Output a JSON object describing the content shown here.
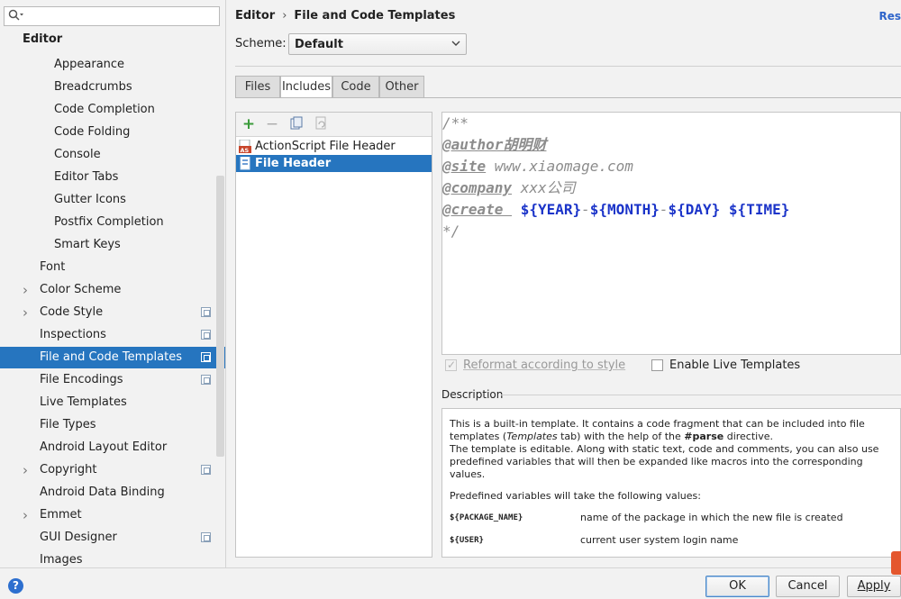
{
  "sidebar": {
    "search_placeholder": "",
    "search_icon": "magnifier-dropdown-icon",
    "root": "Editor",
    "items": [
      {
        "label": "Appearance",
        "indent": 2
      },
      {
        "label": "Breadcrumbs",
        "indent": 2
      },
      {
        "label": "Code Completion",
        "indent": 2
      },
      {
        "label": "Code Folding",
        "indent": 2
      },
      {
        "label": "Console",
        "indent": 2
      },
      {
        "label": "Editor Tabs",
        "indent": 2
      },
      {
        "label": "Gutter Icons",
        "indent": 2
      },
      {
        "label": "Postfix Completion",
        "indent": 2
      },
      {
        "label": "Smart Keys",
        "indent": 2
      },
      {
        "label": "Font",
        "indent": 1
      },
      {
        "label": "Color Scheme",
        "indent": 1,
        "expandable": true
      },
      {
        "label": "Code Style",
        "indent": 1,
        "expandable": true,
        "project": true
      },
      {
        "label": "Inspections",
        "indent": 1,
        "project": true
      },
      {
        "label": "File and Code Templates",
        "indent": 1,
        "project": true,
        "selected": true
      },
      {
        "label": "File Encodings",
        "indent": 1,
        "project": true
      },
      {
        "label": "Live Templates",
        "indent": 1
      },
      {
        "label": "File Types",
        "indent": 1
      },
      {
        "label": "Android Layout Editor",
        "indent": 1
      },
      {
        "label": "Copyright",
        "indent": 1,
        "expandable": true,
        "project": true
      },
      {
        "label": "Android Data Binding",
        "indent": 1
      },
      {
        "label": "Emmet",
        "indent": 1,
        "expandable": true
      },
      {
        "label": "GUI Designer",
        "indent": 1,
        "project": true
      },
      {
        "label": "Images",
        "indent": 1
      }
    ]
  },
  "header": {
    "crumb_parent": "Editor",
    "crumb_sep": "›",
    "crumb_current": "File and Code Templates",
    "reset_label": "Res"
  },
  "scheme": {
    "label": "Scheme:",
    "value": "Default"
  },
  "tabs": [
    "Files",
    "Includes",
    "Code",
    "Other"
  ],
  "active_tab": "Includes",
  "templates": [
    {
      "name": "ActionScript File Header"
    },
    {
      "name": "File Header",
      "selected": true
    }
  ],
  "code": {
    "l1": "/**",
    "l2_tag": "@author",
    "l2_val": "胡明财",
    "l3_tag": "@site",
    "l3_val": " www.xiaomage.com",
    "l4_tag": "@company",
    "l4_val": " xxx公司",
    "l5_tag": "@create ",
    "l5_year": "${YEAR}",
    "l5_month": "${MONTH}",
    "l5_day": "${DAY}",
    "l5_time": "${TIME}",
    "dash": "-",
    "l6": "*/"
  },
  "options": {
    "reformat": "Reformat according to style",
    "live_templates": "Enable Live Templates"
  },
  "description": {
    "label": "Description",
    "p1_a": "This is a built-in template. It contains a code fragment that can be included into file templates (",
    "p1_em": "Templates",
    "p1_b": " tab) with the help of the ",
    "p1_strong": "#parse",
    "p1_c": " directive.",
    "p1_d": "The template is editable. Along with static text, code and comments, you can also use predefined variables that will then be expanded like macros into the corresponding values.",
    "p2": "Predefined variables will take the following values:",
    "vars": [
      {
        "name": "${PACKAGE_NAME}",
        "desc": "name of the package in which the new file is created"
      },
      {
        "name": "${USER}",
        "desc": "current user system login name"
      }
    ]
  },
  "buttons": {
    "ok": "OK",
    "cancel": "Cancel",
    "apply": "Apply",
    "help": "?"
  }
}
